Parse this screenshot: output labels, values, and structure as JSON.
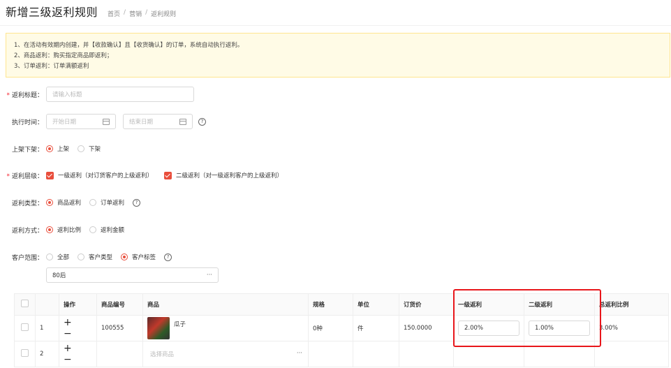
{
  "header": {
    "title": "新增三级返利规则",
    "breadcrumb": [
      "首页",
      "营销",
      "返利规则"
    ]
  },
  "notice": [
    "1、在活动有效期内创建，并【收款确认】且【收货确认】的订单，系统自动执行返利。",
    "2、商品返利：购买指定商品即返利；",
    "3、订单返利：订单满额返利"
  ],
  "form": {
    "title": {
      "label": "返利标题：",
      "placeholder": "请输入标题"
    },
    "exec_time": {
      "label": "执行时间：",
      "start_placeholder": "开始日期",
      "end_placeholder": "结束日期",
      "help": "?"
    },
    "shelf": {
      "label": "上架下架：",
      "options": [
        "上架",
        "下架"
      ],
      "selected": "上架"
    },
    "level": {
      "label": "返利层级：",
      "options": [
        "一级返利（对订货客户的上级返利）",
        "二级返利（对一级返利客户的上级返利）"
      ]
    },
    "type": {
      "label": "返利类型：",
      "options": [
        "商品返利",
        "订单返利"
      ],
      "selected": "商品返利",
      "help": "?"
    },
    "method": {
      "label": "返利方式：",
      "options": [
        "返利比例",
        "返利金额"
      ],
      "selected": "返利比例"
    },
    "scope": {
      "label": "客户范围：",
      "options": [
        "全部",
        "客户类型",
        "客户标签"
      ],
      "selected": "客户标签",
      "help": "?",
      "tag_value": "80后",
      "more": "···"
    }
  },
  "table": {
    "headers": [
      "操作",
      "商品编号",
      "商品",
      "规格",
      "单位",
      "订货价",
      "一级返利",
      "二级返利",
      "总返利比例"
    ],
    "rows": [
      {
        "index": "1",
        "ops": "+ −",
        "code": "100555",
        "product": "瓜子",
        "spec": "0种",
        "unit": "件",
        "price": "150.0000",
        "l1": "2.00%",
        "l2": "1.00%",
        "total": "3.00%"
      },
      {
        "index": "2",
        "ops": "+ −",
        "product_placeholder": "选择商品",
        "more": "···"
      }
    ]
  },
  "colors": {
    "accent": "#e94e3c",
    "highlight": "#e8161b",
    "notice_bg": "#fffbe6"
  }
}
